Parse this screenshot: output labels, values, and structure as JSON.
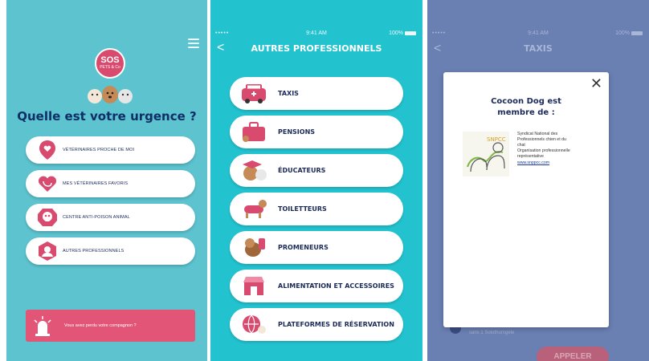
{
  "panel1": {
    "logo": {
      "line1": "SOS",
      "line2": "PETS & Co"
    },
    "title": "Quelle est votre urgence ?",
    "items": [
      {
        "label": "Vétérinaires proche de moi",
        "icon": "location-heart-icon"
      },
      {
        "label": "Mes vétérinaires favoris",
        "icon": "heart-stethoscope-icon"
      },
      {
        "label": "Centre anti-poison animal",
        "icon": "skull-icon"
      },
      {
        "label": "Autres professionnels",
        "icon": "professional-avatar-icon"
      }
    ],
    "alert": {
      "label": "Vous avez perdu votre compagnon ?",
      "icon": "siren-icon"
    }
  },
  "panel2": {
    "status": {
      "signal": "•••••",
      "time": "9:41 AM",
      "battery": "100%"
    },
    "header": "AUTRES PROFESSIONNELS",
    "back": "<",
    "items": [
      {
        "label": "TAXIS",
        "icon": "taxi-icon"
      },
      {
        "label": "PENSIONS",
        "icon": "suitcase-icon"
      },
      {
        "label": "ÉDUCATEURS",
        "icon": "graduate-dog-icon"
      },
      {
        "label": "TOILETTEURS",
        "icon": "groomed-dog-icon"
      },
      {
        "label": "PROMENEURS",
        "icon": "walking-dog-icon"
      },
      {
        "label": "ALIMENTATION ET ACCESSOIRES",
        "icon": "shop-icon"
      },
      {
        "label": "PLATEFORMES DE RÉSERVATION",
        "icon": "globe-pet-icon"
      }
    ]
  },
  "panel3": {
    "status": {
      "signal": "•••••",
      "time": "9:41 AM",
      "battery": "100%"
    },
    "header": "TAXIS",
    "back": "<",
    "bg_text": "sans 1 Solothurngele",
    "call_button": "APPELER",
    "modal": {
      "close": "✕",
      "title_line1": "Cocoon Dog est",
      "title_line2": "membre de :",
      "info_lines": [
        "Syndicat National des",
        "Professionnels chien et du",
        "chat",
        "Organisation professionnelle",
        "représentative"
      ],
      "link": "www.snppcc.com",
      "logo_text": "SNPCC"
    }
  },
  "colors": {
    "panel1_bg": "#5cc3cf",
    "panel2_bg": "#22c3cf",
    "accent_pink": "#e25577",
    "navy": "#0f2f66"
  }
}
